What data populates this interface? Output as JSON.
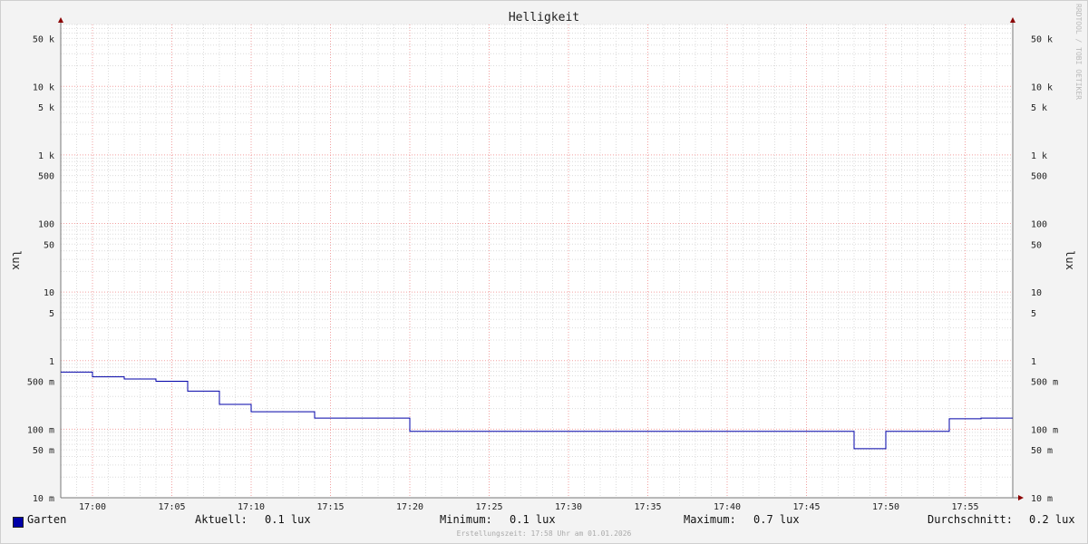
{
  "chart_data": {
    "type": "line",
    "title": "Helligkeit",
    "ylabel": "lux",
    "yscale": "log",
    "ylim": [
      0.01,
      80000
    ],
    "ytick_labels": [
      {
        "value": 50000,
        "label": "50 k"
      },
      {
        "value": 10000,
        "label": "10 k"
      },
      {
        "value": 5000,
        "label": "5 k"
      },
      {
        "value": 1000,
        "label": "1 k"
      },
      {
        "value": 500,
        "label": "500"
      },
      {
        "value": 100,
        "label": "100"
      },
      {
        "value": 50,
        "label": "50"
      },
      {
        "value": 10,
        "label": "10"
      },
      {
        "value": 5,
        "label": "5"
      },
      {
        "value": 1,
        "label": "1"
      },
      {
        "value": 0.5,
        "label": "500 m"
      },
      {
        "value": 0.1,
        "label": "100 m"
      },
      {
        "value": 0.05,
        "label": "50 m"
      },
      {
        "value": 0.01,
        "label": "10 m"
      }
    ],
    "xtick_labels": [
      "17:00",
      "17:05",
      "17:10",
      "17:15",
      "17:20",
      "17:25",
      "17:30",
      "17:35",
      "17:40",
      "17:45",
      "17:50",
      "17:55"
    ],
    "series": [
      {
        "name": "Garten",
        "color": "#0000a8",
        "step": true,
        "points": [
          {
            "x": "16:58",
            "y": 0.68
          },
          {
            "x": "17:00",
            "y": 0.58
          },
          {
            "x": "17:02",
            "y": 0.54
          },
          {
            "x": "17:04",
            "y": 0.5
          },
          {
            "x": "17:06",
            "y": 0.36
          },
          {
            "x": "17:08",
            "y": 0.23
          },
          {
            "x": "17:10",
            "y": 0.18
          },
          {
            "x": "17:14",
            "y": 0.145
          },
          {
            "x": "17:20",
            "y": 0.093
          },
          {
            "x": "17:48",
            "y": 0.052
          },
          {
            "x": "17:50",
            "y": 0.093
          },
          {
            "x": "17:54",
            "y": 0.142
          },
          {
            "x": "17:56",
            "y": 0.145
          }
        ],
        "x_end": "17:58"
      }
    ],
    "grid": true
  },
  "legend": {
    "series_name": "Garten",
    "aktuell_label": "Aktuell:",
    "aktuell_value": "0.1 lux",
    "minimum_label": "Minimum:",
    "minimum_value": "0.1 lux",
    "maximum_label": "Maximum:",
    "maximum_value": "0.7 lux",
    "durchschnitt_label": "Durchschnitt:",
    "durchschnitt_value": "0.2 lux"
  },
  "watermark": "RRDTOOL / TOBI OETIKER",
  "footer": "Erstellungszeit: 17:58 Uhr am 01.01.2026"
}
